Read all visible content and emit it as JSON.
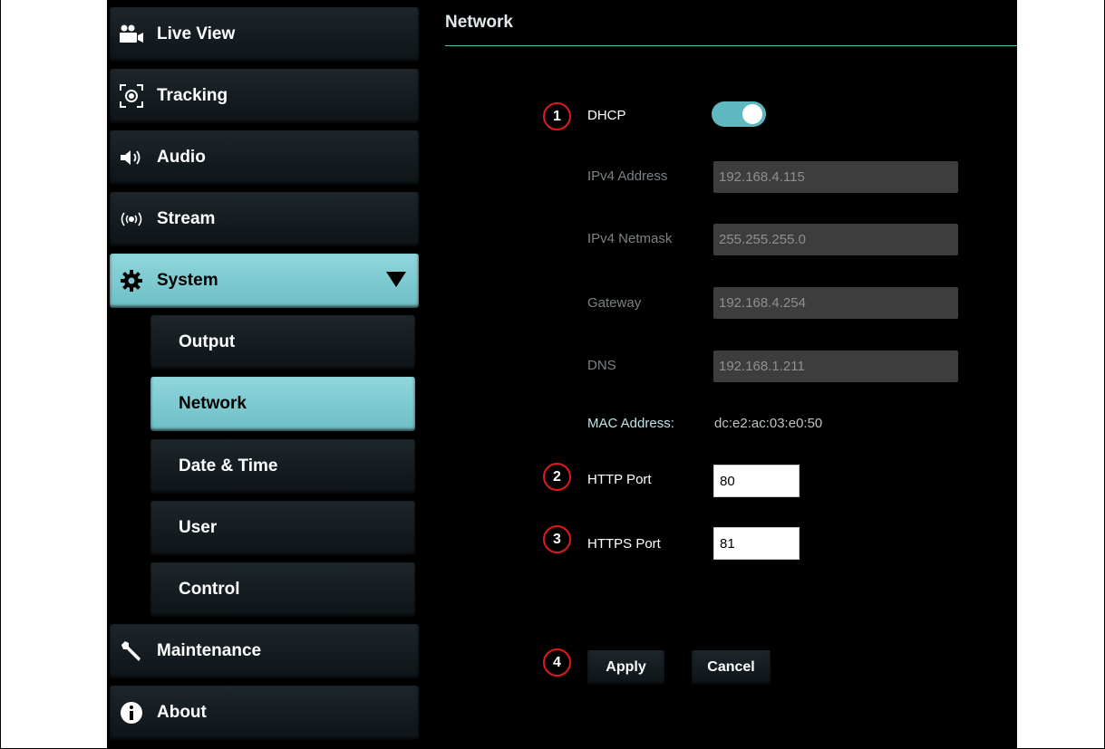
{
  "sidebar": {
    "items": [
      {
        "label": "Live View",
        "icon": "video-camera-icon"
      },
      {
        "label": "Tracking",
        "icon": "tracking-icon"
      },
      {
        "label": "Audio",
        "icon": "speaker-icon"
      },
      {
        "label": "Stream",
        "icon": "broadcast-icon"
      },
      {
        "label": "System",
        "icon": "gear-icon",
        "expanded": true
      },
      {
        "label": "Maintenance",
        "icon": "wrench-icon"
      },
      {
        "label": "About",
        "icon": "info-icon"
      }
    ],
    "system_sub": [
      {
        "label": "Output"
      },
      {
        "label": "Network",
        "active": true
      },
      {
        "label": "Date & Time"
      },
      {
        "label": "User"
      },
      {
        "label": "Control"
      }
    ]
  },
  "main": {
    "title": "Network",
    "dhcp": {
      "badge": "1",
      "label": "DHCP",
      "enabled": true
    },
    "ipv4_address": {
      "label": "IPv4 Address",
      "value": "192.168.4.115"
    },
    "ipv4_netmask": {
      "label": "IPv4 Netmask",
      "value": "255.255.255.0"
    },
    "gateway": {
      "label": "Gateway",
      "value": "192.168.4.254"
    },
    "dns": {
      "label": "DNS",
      "value": "192.168.1.211"
    },
    "mac": {
      "label": "MAC Address:",
      "value": "dc:e2:ac:03:e0:50"
    },
    "http_port": {
      "badge": "2",
      "label": "HTTP Port",
      "value": "80"
    },
    "https_port": {
      "badge": "3",
      "label": "HTTPS Port",
      "value": "81"
    },
    "actions": {
      "badge": "4",
      "apply": "Apply",
      "cancel": "Cancel"
    }
  },
  "colors": {
    "accent": "#6ebfc6",
    "badge_border": "#e01a1a",
    "background": "#000000",
    "field_bg": "#3d3d3d"
  }
}
